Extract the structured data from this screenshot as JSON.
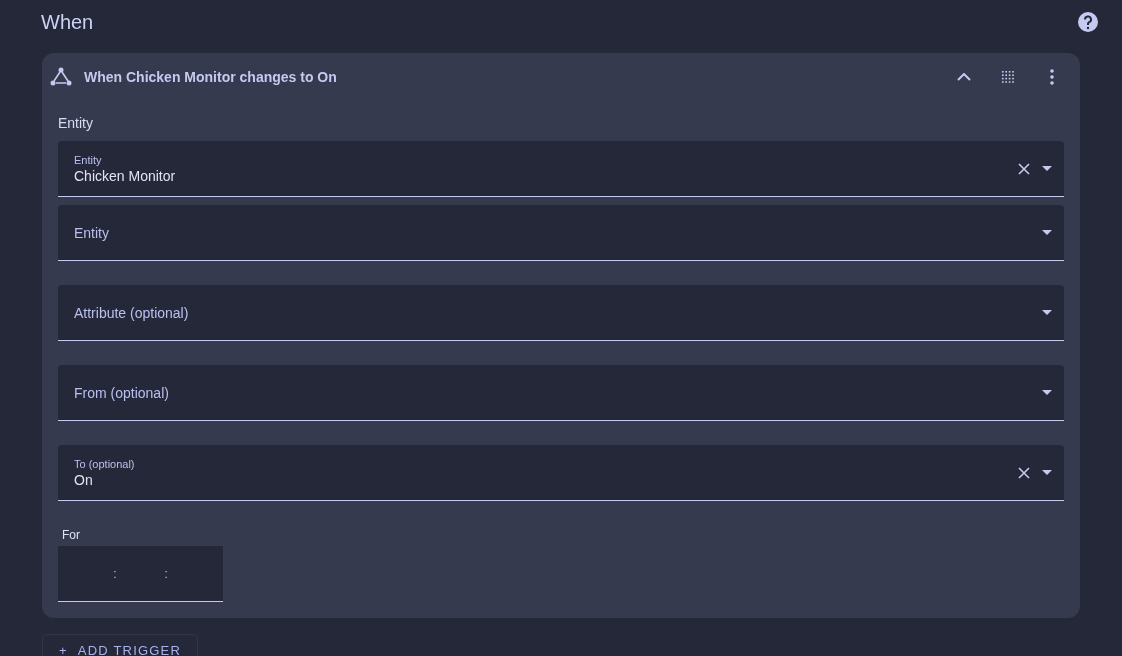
{
  "section": {
    "title": "When"
  },
  "trigger": {
    "title": "When Chicken Monitor changes to On",
    "expanded": true,
    "entity_heading": "Entity",
    "fields": [
      {
        "label": "Entity",
        "value": "Chicken Monitor",
        "clearable": true
      },
      {
        "label": "Entity",
        "clearable": false
      },
      {
        "label": "Attribute (optional)",
        "clearable": false
      },
      {
        "label": "From (optional)",
        "clearable": false
      },
      {
        "label": "To (optional)",
        "value": "On",
        "clearable": true
      }
    ],
    "duration": {
      "label": "For",
      "separators": [
        ":",
        ":"
      ]
    }
  },
  "add_button": {
    "icon": "+",
    "label": "ADD TRIGGER"
  }
}
